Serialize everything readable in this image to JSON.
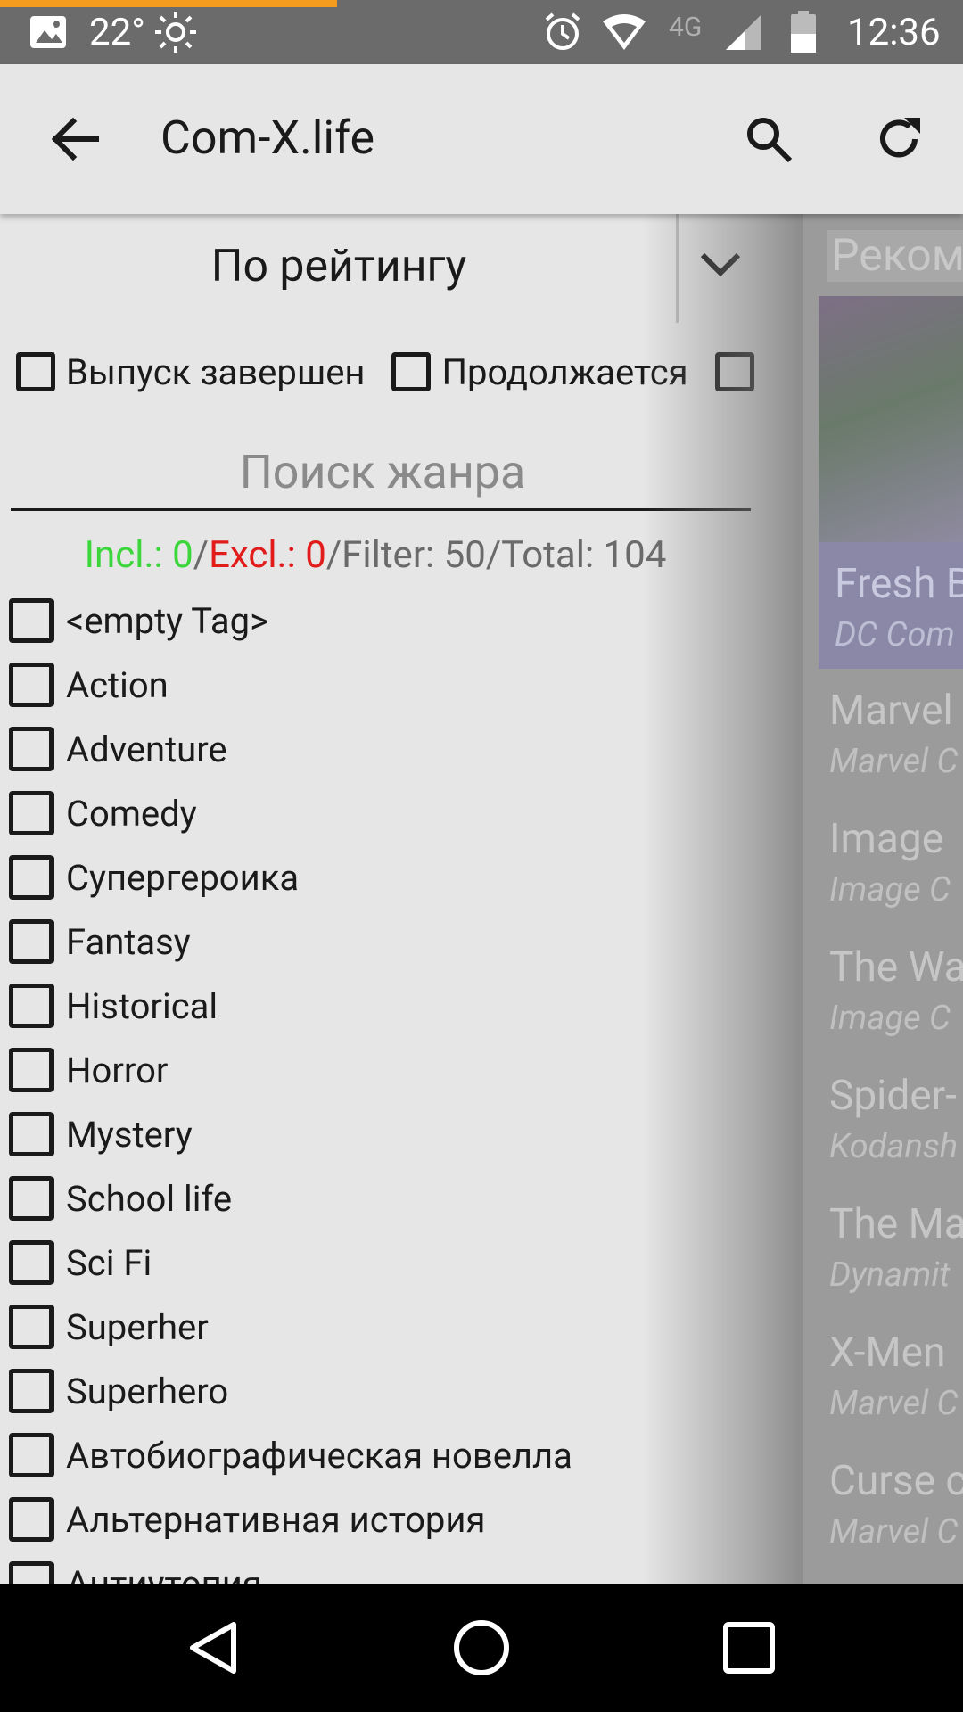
{
  "status_bar": {
    "temperature": "22°",
    "network": "4G",
    "time": "12:36"
  },
  "app_bar": {
    "title": "Com-X.life",
    "icons": [
      "back-arrow-icon",
      "search-icon",
      "refresh-icon"
    ]
  },
  "filter_drawer": {
    "sort_label": "По рейтингу",
    "status_filters": [
      {
        "label": "Выпуск завершен",
        "checked": false
      },
      {
        "label": "Продолжается",
        "checked": false
      }
    ],
    "genre_search_placeholder": "Поиск жанра",
    "counts": {
      "incl_label": "Incl.: ",
      "incl_value": "0",
      "excl_label": "Excl.: ",
      "excl_value": "0",
      "rest": "/Filter: 50/Total: 104"
    },
    "genres": [
      "<empty Tag>",
      "Action",
      "Adventure",
      "Comedy",
      "Супергероика",
      "Fantasy",
      "Historical",
      "Horror",
      "Mystery",
      "School life",
      "Sci Fi",
      "Superher",
      "Superhero",
      "Автобиографическая новелла",
      "Альтернативная история",
      "Антиутопия"
    ]
  },
  "background_list": {
    "header": "Реком",
    "featured": {
      "title": "Fresh B",
      "publisher": "DC Com"
    },
    "items": [
      {
        "title": "Marvel",
        "publisher": "Marvel C"
      },
      {
        "title": "Image",
        "publisher": "Image C"
      },
      {
        "title": "The Wa",
        "publisher": "Image C"
      },
      {
        "title": "Spider-",
        "publisher": "Kodansh"
      },
      {
        "title": "The Ma",
        "publisher": "Dynamit"
      },
      {
        "title": "X-Men",
        "publisher": "Marvel C"
      },
      {
        "title": "Curse c",
        "publisher": "Marvel C"
      }
    ]
  },
  "colors": {
    "accent": "#f59b1e",
    "include": "#3ad63a",
    "exclude": "#e21b1b"
  }
}
